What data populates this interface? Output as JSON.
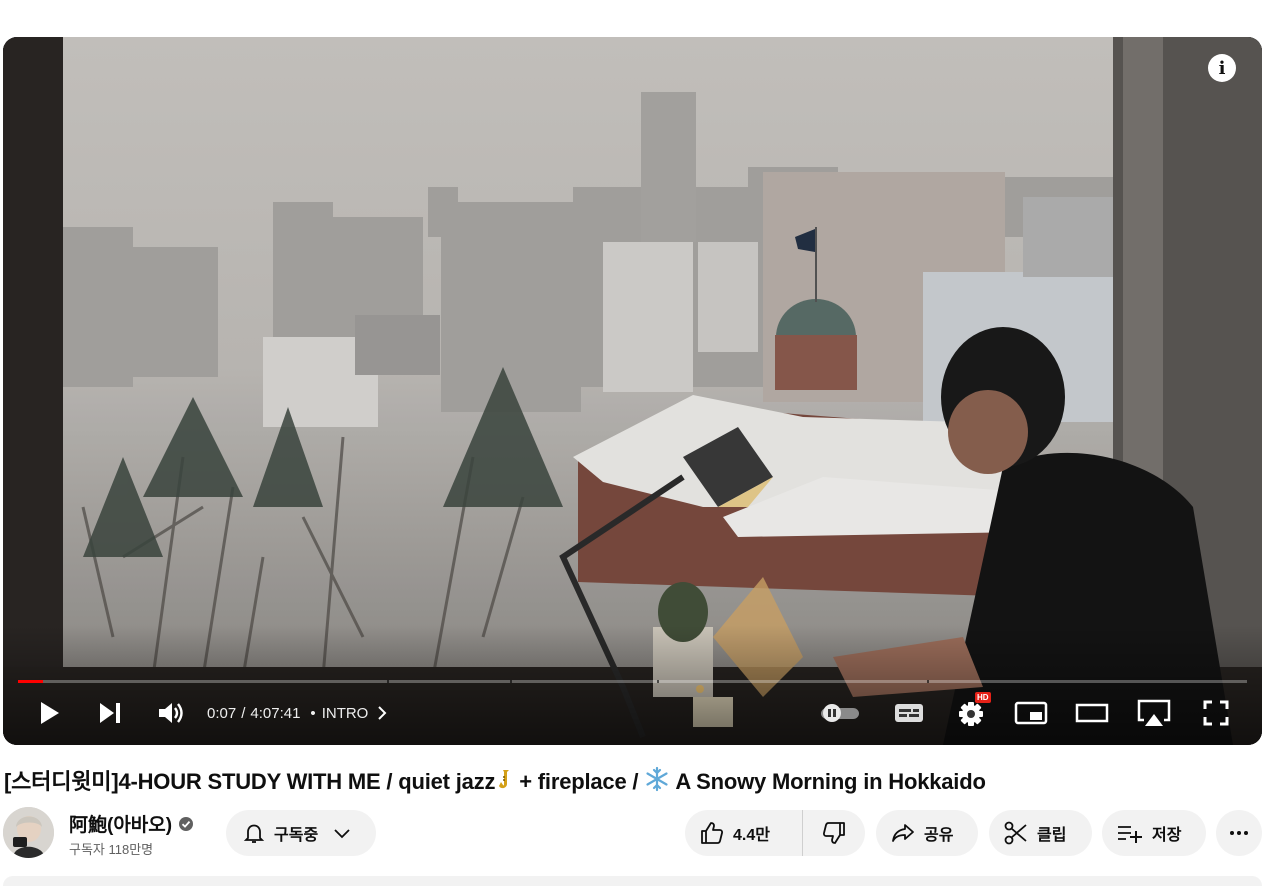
{
  "video": {
    "current_time": "0:07",
    "duration": "4:07:41",
    "separator": "/",
    "chapter_dot": "•",
    "chapter": "INTRO",
    "progress_fraction": 0.0005,
    "info_label": "i",
    "hd_badge": "HD"
  },
  "title": {
    "part1": "[스터디윗미]4-HOUR STUDY WITH ME / quiet jazz",
    "part2": "+ fireplace / ",
    "part3": " A Snowy Morning in Hokkaido",
    "icon1": "saxophone-emoji",
    "icon2": "snowflake-emoji"
  },
  "channel": {
    "name": "阿鮑(아바오)",
    "subscribers": "구독자 118만명"
  },
  "actions": {
    "subscribe_label": "구독중",
    "like_count": "4.4만",
    "share_label": "공유",
    "clip_label": "클립",
    "save_label": "저장"
  },
  "colors": {
    "progress": "#ff0000",
    "pill_bg": "#f2f2f2",
    "hd_badge": "#e62117"
  }
}
